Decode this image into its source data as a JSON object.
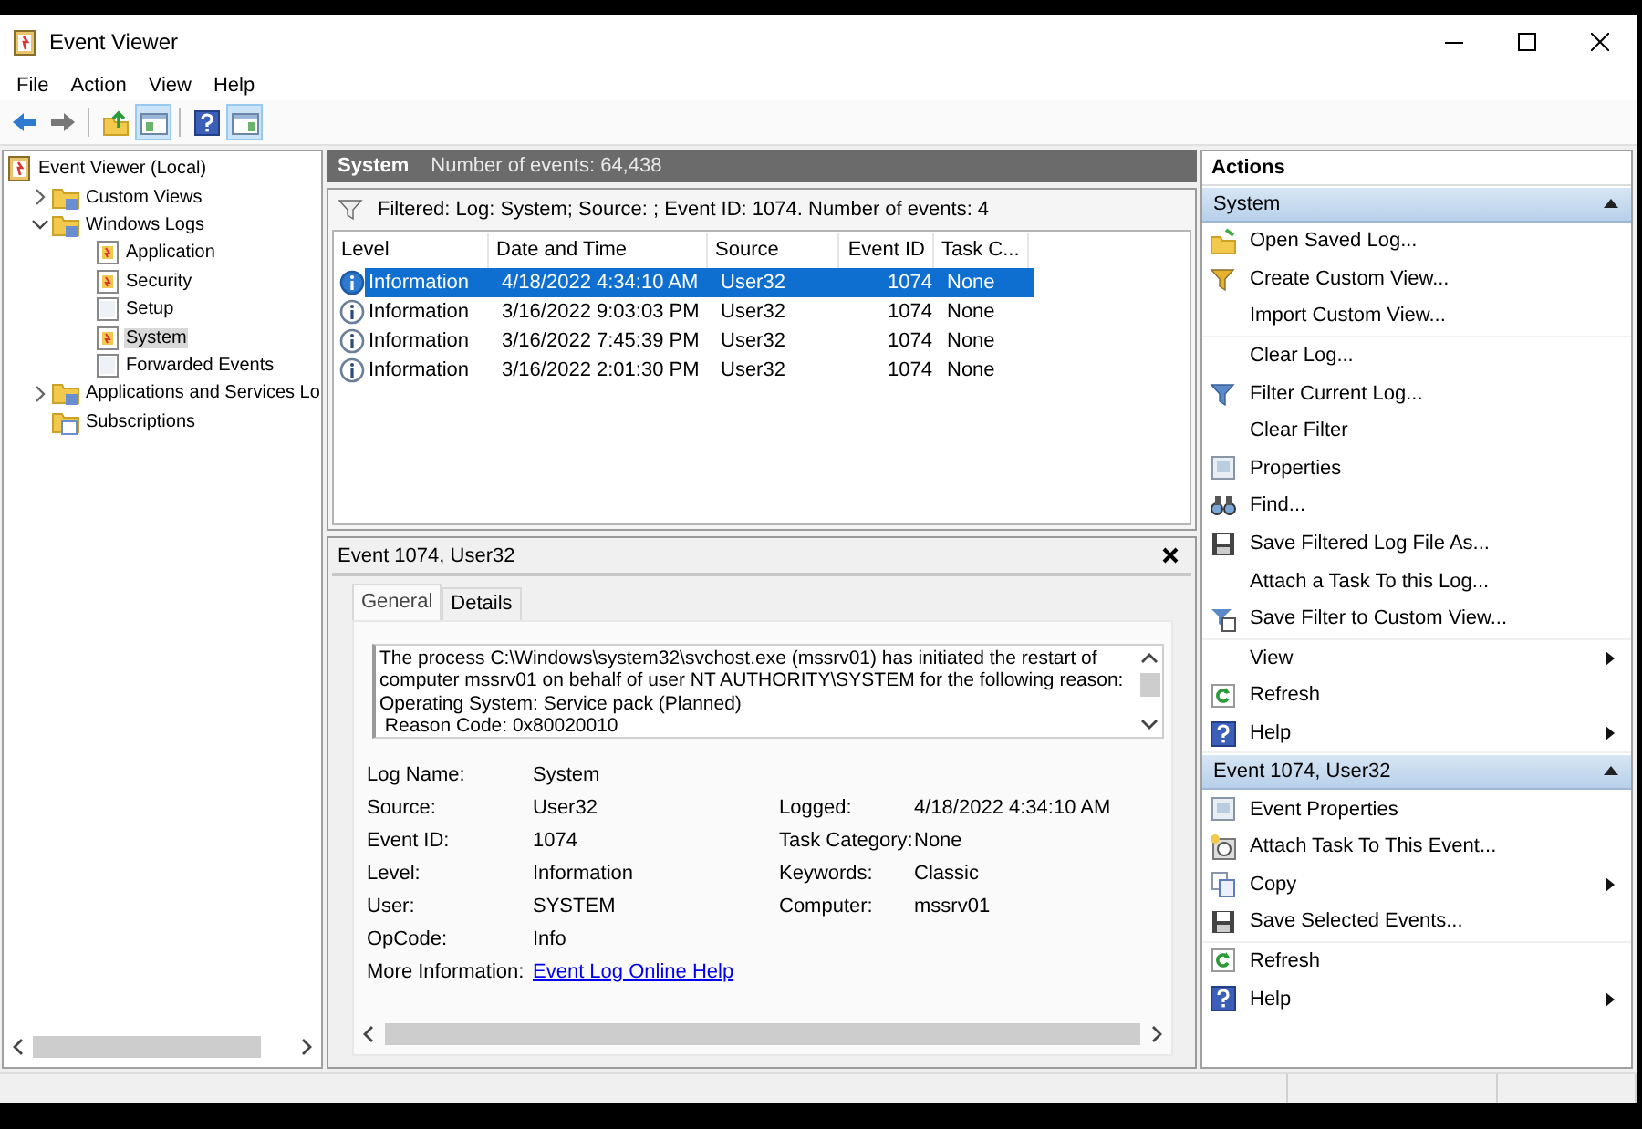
{
  "window": {
    "title": "Event Viewer"
  },
  "menu": [
    "File",
    "Action",
    "View",
    "Help"
  ],
  "toolbar": [
    {
      "kind": "back",
      "pressed": false
    },
    {
      "kind": "forward",
      "pressed": false
    },
    {
      "kind": "up",
      "pressed": false
    },
    {
      "kind": "tree-pane",
      "pressed": true
    },
    {
      "kind": "help",
      "pressed": false
    },
    {
      "kind": "action-pane",
      "pressed": true
    }
  ],
  "tree": [
    {
      "label": "Event Viewer (Local)",
      "kind": "root",
      "selected": false,
      "children": [
        {
          "label": "Custom Views",
          "kind": "folder",
          "expanded": false,
          "selected": false
        },
        {
          "label": "Windows Logs",
          "kind": "folder",
          "expanded": true,
          "selected": false,
          "children": [
            {
              "label": "Application",
              "kind": "log",
              "selected": false
            },
            {
              "label": "Security",
              "kind": "log",
              "selected": false
            },
            {
              "label": "Setup",
              "kind": "page",
              "selected": false
            },
            {
              "label": "System",
              "kind": "log",
              "selected": true
            },
            {
              "label": "Forwarded Events",
              "kind": "page",
              "selected": false
            }
          ]
        },
        {
          "label": "Applications and Services Lo",
          "kind": "folder",
          "expanded": false,
          "selected": false
        },
        {
          "label": "Subscriptions",
          "kind": "subscriptions",
          "selected": false
        }
      ]
    }
  ],
  "log_header": {
    "title": "System",
    "count": "Number of events: 64,438"
  },
  "filter": "Filtered: Log: System; Source: ; Event ID: 1074. Number of events: 4",
  "table": {
    "columns": [
      "Level",
      "Date and Time",
      "Source",
      "Event ID",
      "Task C..."
    ],
    "rows": [
      {
        "level": "Information",
        "date": "4/18/2022 4:34:10 AM",
        "source": "User32",
        "event_id": "1074",
        "task": "None",
        "selected": true
      },
      {
        "level": "Information",
        "date": "3/16/2022 9:03:03 PM",
        "source": "User32",
        "event_id": "1074",
        "task": "None",
        "selected": false
      },
      {
        "level": "Information",
        "date": "3/16/2022 7:45:39 PM",
        "source": "User32",
        "event_id": "1074",
        "task": "None",
        "selected": false
      },
      {
        "level": "Information",
        "date": "3/16/2022 2:01:30 PM",
        "source": "User32",
        "event_id": "1074",
        "task": "None",
        "selected": false
      }
    ]
  },
  "detail": {
    "title": "Event 1074, User32",
    "tabs": [
      {
        "label": "General",
        "selected": true
      },
      {
        "label": "Details",
        "selected": false
      }
    ],
    "message": [
      "The process C:\\Windows\\system32\\svchost.exe (mssrv01) has initiated the restart of computer mssrv01 on behalf of user NT AUTHORITY\\SYSTEM for the following reason: Operating System: Service pack (Planned)",
      " Reason Code: 0x80020010"
    ],
    "fields": [
      {
        "label": "Log Name:",
        "value": "System"
      },
      {
        "label": "Source:",
        "value": "User32"
      },
      {
        "label": "Event ID:",
        "value": "1074"
      },
      {
        "label": "Level:",
        "value": "Information"
      },
      {
        "label": "User:",
        "value": "SYSTEM"
      },
      {
        "label": "OpCode:",
        "value": "Info"
      }
    ],
    "side_fields": [
      {
        "label": "Logged:",
        "value": "4/18/2022 4:34:10 AM"
      },
      {
        "label": "Task Category:",
        "value": "None"
      },
      {
        "label": "Keywords:",
        "value": "Classic"
      },
      {
        "label": "Computer:",
        "value": "mssrv01"
      }
    ],
    "more_info": {
      "label": "More Information:",
      "link": "Event Log Online Help"
    }
  },
  "actions": {
    "title": "Actions",
    "sections": [
      {
        "title": "System",
        "expanded": true,
        "groups": [
          [
            {
              "label": "Open Saved Log...",
              "kind": "open",
              "submenu": false
            },
            {
              "label": "Create Custom View...",
              "kind": "create-view",
              "submenu": false
            },
            {
              "label": "Import Custom View...",
              "kind": "plain",
              "submenu": false
            }
          ],
          [
            {
              "label": "Clear Log...",
              "kind": "plain",
              "submenu": false
            },
            {
              "label": "Filter Current Log...",
              "kind": "filter",
              "submenu": false
            },
            {
              "label": "Clear Filter",
              "kind": "plain",
              "submenu": false
            },
            {
              "label": "Properties",
              "kind": "properties",
              "submenu": false
            },
            {
              "label": "Find...",
              "kind": "find",
              "submenu": false
            },
            {
              "label": "Save Filtered Log File As...",
              "kind": "save",
              "submenu": false
            },
            {
              "label": "Attach a Task To this Log...",
              "kind": "plain",
              "submenu": false
            },
            {
              "label": "Save Filter to Custom View...",
              "kind": "save-filter",
              "submenu": false
            }
          ],
          [
            {
              "label": "View",
              "kind": "plain",
              "submenu": true
            },
            {
              "label": "Refresh",
              "kind": "refresh",
              "submenu": false
            },
            {
              "label": "Help",
              "kind": "help",
              "submenu": true
            }
          ]
        ]
      },
      {
        "title": "Event 1074, User32",
        "expanded": true,
        "groups": [
          [
            {
              "label": "Event Properties",
              "kind": "properties",
              "submenu": false
            },
            {
              "label": "Attach Task To This Event...",
              "kind": "attach-task",
              "submenu": false
            },
            {
              "label": "Copy",
              "kind": "copy",
              "submenu": true
            },
            {
              "label": "Save Selected Events...",
              "kind": "save",
              "submenu": false
            }
          ],
          [
            {
              "label": "Refresh",
              "kind": "refresh",
              "submenu": false
            },
            {
              "label": "Help",
              "kind": "help",
              "submenu": true
            }
          ]
        ]
      }
    ]
  }
}
